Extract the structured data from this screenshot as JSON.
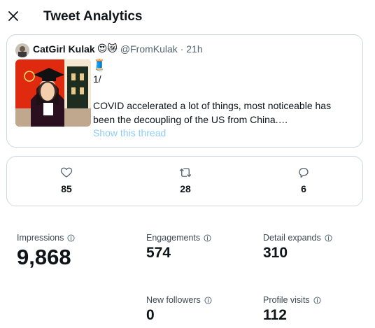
{
  "header": {
    "title": "Tweet Analytics"
  },
  "tweet": {
    "author_name": "CatGirl Kulak",
    "author_emojis": "😍😿",
    "handle_time": "@FromKulak · 21h",
    "thread_emoji": "🧵",
    "line1": "1/",
    "text": "COVID accelerated a lot of things, most noticeable has been the decoupling of the US from China.…",
    "show_thread": "Show this thread"
  },
  "engagement": {
    "likes": "85",
    "retweets": "28",
    "replies": "6"
  },
  "metrics": {
    "impressions": {
      "label": "Impressions",
      "value": "9,868"
    },
    "engagements": {
      "label": "Engagements",
      "value": "574"
    },
    "detail_expands": {
      "label": "Detail expands",
      "value": "310"
    },
    "new_followers": {
      "label": "New followers",
      "value": "0"
    },
    "profile_visits": {
      "label": "Profile visits",
      "value": "112"
    }
  },
  "icons": {
    "close": "close-icon",
    "like": "heart-icon",
    "retweet": "retweet-icon",
    "reply": "reply-icon",
    "info": "info-icon"
  },
  "colors": {
    "link": "#8ecdf8",
    "border": "#cfd9de",
    "text": "#0f1419",
    "muted": "#536471"
  }
}
